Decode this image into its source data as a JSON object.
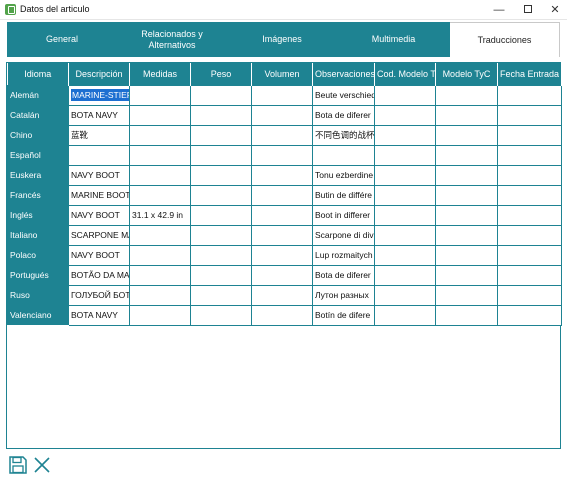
{
  "window": {
    "title": "Datos del articulo",
    "controls": {
      "minimize": "—",
      "close": "✕"
    }
  },
  "tabs": [
    {
      "label": "General",
      "active": false
    },
    {
      "label": "Relacionados y\nAlternativos",
      "active": false
    },
    {
      "label": "Imágenes",
      "active": false
    },
    {
      "label": "Multimedia",
      "active": false
    },
    {
      "label": "Traducciones",
      "active": true
    }
  ],
  "grid": {
    "columns": [
      "Idioma",
      "Descripción",
      "Medidas",
      "Peso",
      "Volumen",
      "Observaciones",
      "Cod. Modelo Ty",
      "Modelo TyC",
      "Fecha Entrada"
    ],
    "rows": [
      {
        "lang": "Alemán",
        "descripcion": "MARINE-STIEF",
        "medidas": "",
        "obs": "Beute verschied",
        "selected": true
      },
      {
        "lang": "Catalán",
        "descripcion": "BOTA NAVY",
        "medidas": "",
        "obs": "Bota de diferer"
      },
      {
        "lang": "Chino",
        "descripcion": "蓝靴",
        "medidas": "",
        "obs": "不同色调的战杯"
      },
      {
        "lang": "Español",
        "descripcion": "",
        "medidas": "",
        "obs": ""
      },
      {
        "lang": "Euskera",
        "descripcion": "NAVY BOOT",
        "medidas": "",
        "obs": "Tonu ezberdine"
      },
      {
        "lang": "Francés",
        "descripcion": "MARINE BOOT",
        "medidas": "",
        "obs": "Butin de différe"
      },
      {
        "lang": "Inglés",
        "descripcion": "NAVY BOOT",
        "medidas": "31.1 x 42.9 in",
        "obs": "Boot in differer"
      },
      {
        "lang": "Italiano",
        "descripcion": "SCARPONE MA",
        "medidas": "",
        "obs": "Scarpone di div"
      },
      {
        "lang": "Polaco",
        "descripcion": "NAVY BOOT",
        "medidas": "",
        "obs": "Lup rozmaitych"
      },
      {
        "lang": "Portugués",
        "descripcion": "BOTÃO DA MA",
        "medidas": "",
        "obs": "Bota de diferer"
      },
      {
        "lang": "Ruso",
        "descripcion": "ГОЛУБОЙ БОТ",
        "medidas": "",
        "obs": "Лутон разных"
      },
      {
        "lang": "Valenciano",
        "descripcion": "BOTA NAVY",
        "medidas": "",
        "obs": "Botín de difere"
      }
    ]
  },
  "footer": {
    "save_icon": "floppy-disk-save-icon",
    "cancel_icon": "x-cancel-icon"
  },
  "colors": {
    "accent": "#1e8392",
    "selection": "#1d6fd1"
  }
}
